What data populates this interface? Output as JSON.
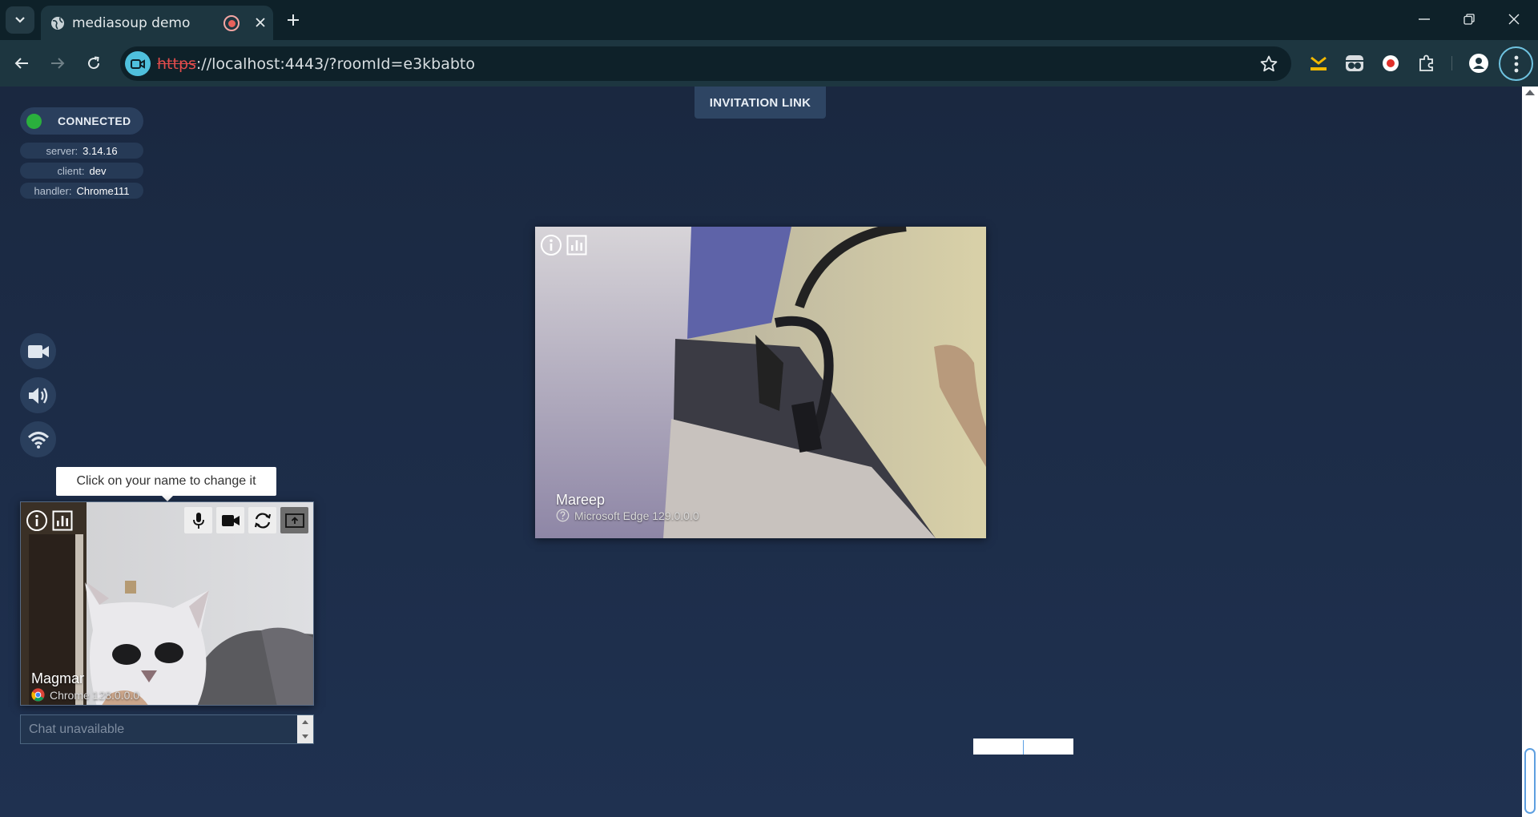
{
  "browser": {
    "tab": {
      "title": "mediasoup demo"
    },
    "address": {
      "scheme": "https",
      "rest": "://localhost:4443/?roomId=e3kbabto"
    }
  },
  "page": {
    "invitation_label": "INVITATION LINK",
    "connection": {
      "status": "CONNECTED",
      "status_color": "#2ab03d",
      "server_key": "server:",
      "server_value": "3.14.16",
      "client_key": "client:",
      "client_value": "dev",
      "handler_key": "handler:",
      "handler_value": "Chrome111"
    },
    "side_buttons": [
      "camera-icon",
      "speaker-icon",
      "wifi-icon"
    ],
    "tooltip": "Click on your name to change it",
    "local_peer": {
      "name": "Magmar",
      "user_agent": "Chrome 128.0.0.0",
      "controls": [
        "mic-icon",
        "webcam-icon",
        "switch-camera-icon",
        "share-screen-icon"
      ]
    },
    "remote_peer": {
      "name": "Mareep",
      "user_agent": "Microsoft Edge 129.0.0.0"
    },
    "chat": {
      "placeholder": "Chat unavailable"
    }
  }
}
